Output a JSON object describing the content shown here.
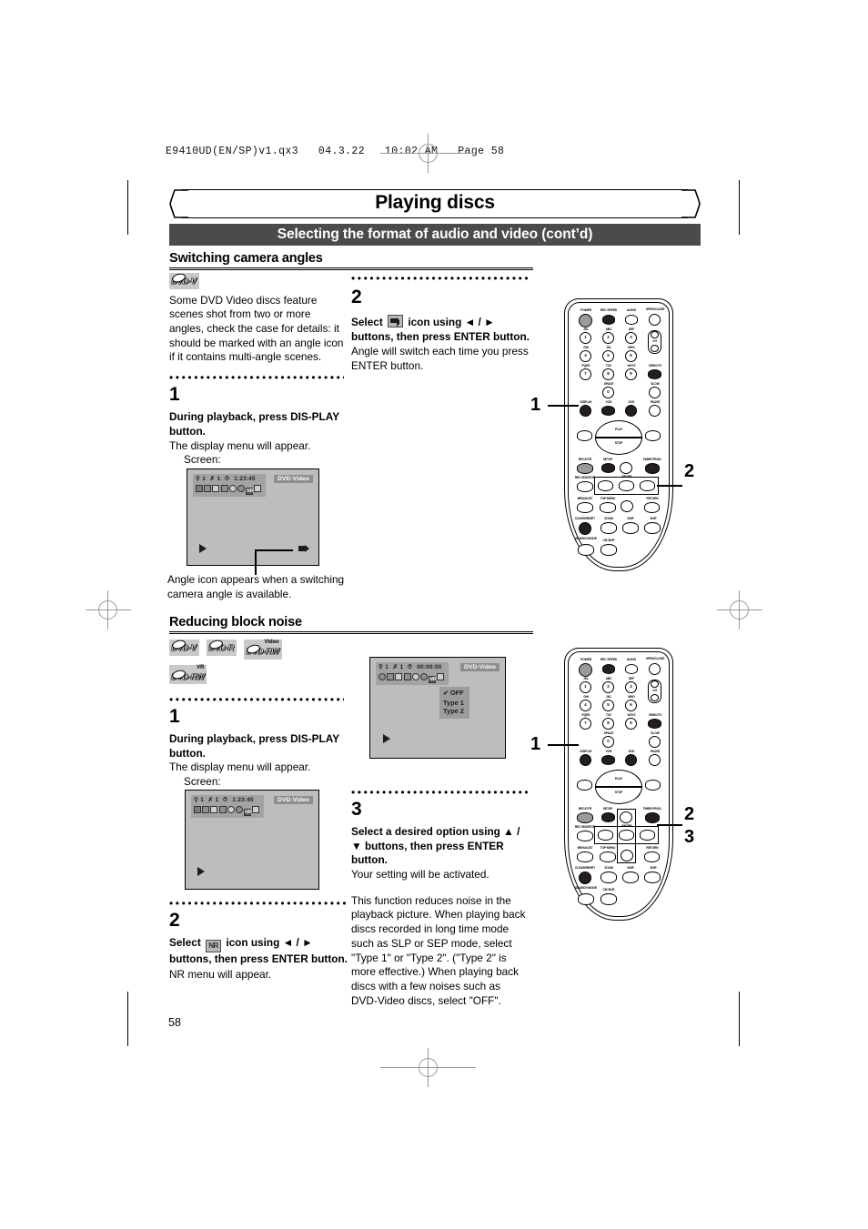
{
  "print_header": "E9410UD(EN/SP)v1.qx3   04.3.22   10:02 AM   Page 58",
  "page_number": "58",
  "banner": {
    "title": "Playing discs",
    "subtitle": "Selecting the format of audio and video (cont’d)",
    "accent": "#4b4b4b"
  },
  "sections": [
    {
      "id": "switching-camera-angles",
      "title": "Switching camera angles",
      "badges": [
        {
          "text": "DVD-V",
          "sup": ""
        }
      ],
      "intro": "Some DVD Video discs feature scenes shot from two or more angles, check the case for details: it should be marked with an angle icon if it contains multi-angle scenes.",
      "steps": [
        {
          "num": "1",
          "bold": "During playback, press DIS-PLAY button.",
          "body": "The display menu will appear.",
          "screen_label": "Screen:",
          "caption": "Angle icon appears when a switching camera angle is available."
        },
        {
          "num": "2",
          "bold_pre": "Select",
          "icon": "angle-camera-icon",
          "bold_post": "icon using ◄ / ► buttons, then press ENTER button.",
          "body": "Angle will switch each time you press ENTER button."
        }
      ]
    },
    {
      "id": "reducing-block-noise",
      "title": "Reducing block noise",
      "badges": [
        {
          "text": "DVD-V",
          "sup": ""
        },
        {
          "text": "DVD-R",
          "sup": ""
        },
        {
          "text": "DVD-RW",
          "sup": "Video"
        },
        {
          "text": "DVD-RW",
          "sup": "VR"
        }
      ],
      "steps": [
        {
          "num": "1",
          "bold": "During playback, press DIS-PLAY button.",
          "body": "The display menu will appear.",
          "screen_label": "Screen:"
        },
        {
          "num": "2",
          "bold_pre": "Select",
          "icon": "nr-icon",
          "bold_post": "icon using ◄ / ► buttons, then press ENTER button.",
          "body": "NR menu will appear."
        },
        {
          "num": "3",
          "bold": "Select a desired option using ▲ / ▼ buttons, then press ENTER button.",
          "body": "Your setting will be activated.",
          "note": "This function reduces noise in the playback picture. When playing back discs recorded in long time mode such as SLP or SEP mode, select \"Type 1\" or \"Type 2\". (\"Type 2\" is more effective.) When playing back discs with a few noises such as DVD-Video discs, select \"OFF\"."
        }
      ]
    }
  ],
  "osd_screens": [
    {
      "id": "angle-osd",
      "title_chapter": "1",
      "title_track": "1",
      "time": "1:23:45",
      "disc_tag": "DVD-Video",
      "play_indicator": "►",
      "angle_icon": "camera-angle-icon"
    },
    {
      "id": "display-osd",
      "title_chapter": "1",
      "title_track": "1",
      "time": "1:23:45",
      "disc_tag": "DVD-Video",
      "play_indicator": "►"
    },
    {
      "id": "nr-osd",
      "title_chapter": "1",
      "title_track": "1",
      "time": "00:00:00",
      "disc_tag": "DVD-Video",
      "play_indicator": "►",
      "menu": {
        "selected": "OFF",
        "options": [
          "OFF",
          "Type 1",
          "Type 2"
        ]
      }
    }
  ],
  "remote": {
    "labels": {
      "power": "POWER",
      "rec_speed": "REC SPEED",
      "audio": "AUDIO",
      "open_close": "OPEN/CLOSE",
      "ch": "CH",
      "display": "DISPLAY",
      "vcr": "VCR",
      "dvd": "DVD",
      "pause": "PAUSE",
      "play": "PLAY",
      "stop": "STOP",
      "slow": "SLOW",
      "space": "SPACE",
      "rec_otr": "REC/OTR",
      "setup": "SETUP",
      "timer_prog": "TIMER PROG.",
      "rec_monitor": "REC MONITOR",
      "enter": "ENTER",
      "menu_list": "MENU/LIST",
      "top_menu": "TOP MENU",
      "return": "RETURN",
      "clear_reset": "CLEAR/RESET",
      "zoom": "ZOOM",
      "skip_back": "SKIP",
      "skip_fwd": "SKIP",
      "search_mode": "SEARCH MODE",
      "cm_skip": "CM SKIP"
    },
    "keypad": [
      {
        "num": "1",
        "letters": "JKL"
      },
      {
        "num": "2",
        "letters": "ABC"
      },
      {
        "num": "3",
        "letters": "DEF"
      },
      {
        "num": "4",
        "letters": "GHI"
      },
      {
        "num": "5",
        "letters": "JKL"
      },
      {
        "num": "6",
        "letters": "MNO"
      },
      {
        "num": "7",
        "letters": "PQRS"
      },
      {
        "num": "8",
        "letters": "TUV"
      },
      {
        "num": "9",
        "letters": "WXYZ"
      },
      {
        "num": "0",
        "letters": "SPACE"
      }
    ],
    "keypad_top_row_letters": [
      "JKL",
      "ABC",
      "DEF"
    ],
    "video_tv": "VIDEO/TV",
    "callouts_top": [
      "1",
      "2"
    ],
    "callouts_bottom": [
      "1",
      "2",
      "3"
    ]
  }
}
